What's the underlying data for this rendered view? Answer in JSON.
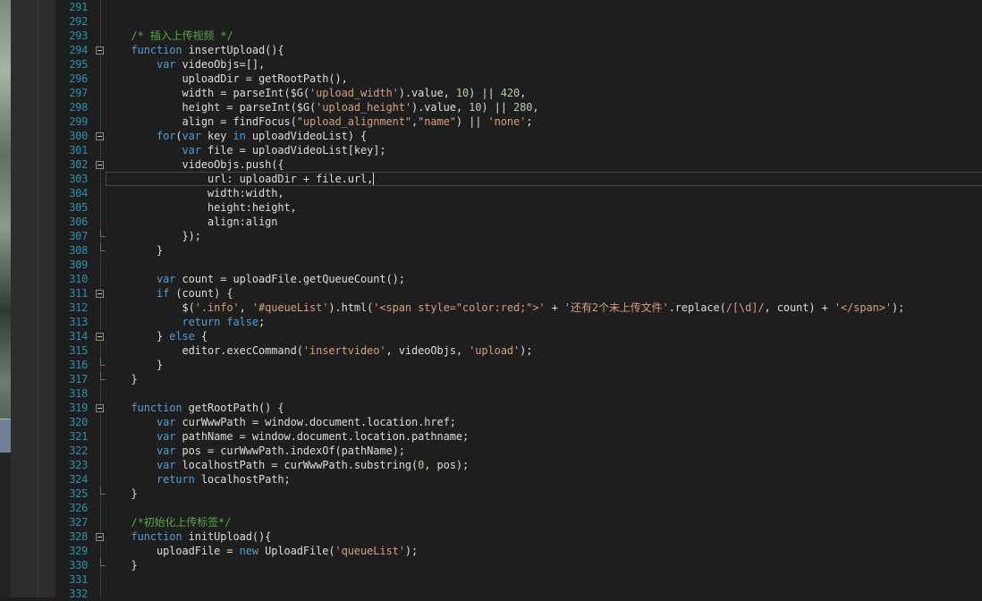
{
  "editor": {
    "lines": [
      {
        "num": "291",
        "tokens": []
      },
      {
        "num": "292",
        "tokens": []
      },
      {
        "num": "293",
        "tokens": [
          {
            "t": "    ",
            "c": "tx"
          },
          {
            "t": "/* 插入上传视频 */",
            "c": "cm"
          }
        ]
      },
      {
        "num": "294",
        "fold": "open",
        "tokens": [
          {
            "t": "    ",
            "c": "tx"
          },
          {
            "t": "function",
            "c": "kw"
          },
          {
            "t": " insertUpload(){",
            "c": "tx"
          }
        ]
      },
      {
        "num": "295",
        "tokens": [
          {
            "t": "        ",
            "c": "tx"
          },
          {
            "t": "var",
            "c": "kw"
          },
          {
            "t": " videoObjs=[],",
            "c": "tx"
          }
        ]
      },
      {
        "num": "296",
        "tokens": [
          {
            "t": "            uploadDir = getRootPath(),",
            "c": "tx"
          }
        ]
      },
      {
        "num": "297",
        "tokens": [
          {
            "t": "            width = parseInt($G(",
            "c": "tx"
          },
          {
            "t": "'upload_width'",
            "c": "str"
          },
          {
            "t": ").value, ",
            "c": "tx"
          },
          {
            "t": "10",
            "c": "num"
          },
          {
            "t": ") || ",
            "c": "tx"
          },
          {
            "t": "420",
            "c": "num"
          },
          {
            "t": ",",
            "c": "tx"
          }
        ]
      },
      {
        "num": "298",
        "tokens": [
          {
            "t": "            height = parseInt($G(",
            "c": "tx"
          },
          {
            "t": "'upload_height'",
            "c": "str"
          },
          {
            "t": ").value, ",
            "c": "tx"
          },
          {
            "t": "10",
            "c": "num"
          },
          {
            "t": ") || ",
            "c": "tx"
          },
          {
            "t": "280",
            "c": "num"
          },
          {
            "t": ",",
            "c": "tx"
          }
        ]
      },
      {
        "num": "299",
        "tokens": [
          {
            "t": "            align = findFocus(",
            "c": "tx"
          },
          {
            "t": "\"upload_alignment\"",
            "c": "str"
          },
          {
            "t": ",",
            "c": "tx"
          },
          {
            "t": "\"name\"",
            "c": "str"
          },
          {
            "t": ") || ",
            "c": "tx"
          },
          {
            "t": "'none'",
            "c": "str"
          },
          {
            "t": ";",
            "c": "tx"
          }
        ]
      },
      {
        "num": "300",
        "fold": "open",
        "tokens": [
          {
            "t": "        ",
            "c": "tx"
          },
          {
            "t": "for",
            "c": "kw"
          },
          {
            "t": "(",
            "c": "tx"
          },
          {
            "t": "var",
            "c": "kw"
          },
          {
            "t": " key ",
            "c": "tx"
          },
          {
            "t": "in",
            "c": "kw"
          },
          {
            "t": " uploadVideoList) {",
            "c": "tx"
          }
        ]
      },
      {
        "num": "301",
        "tokens": [
          {
            "t": "            ",
            "c": "tx"
          },
          {
            "t": "var",
            "c": "kw"
          },
          {
            "t": " file = uploadVideoList[key];",
            "c": "tx"
          }
        ]
      },
      {
        "num": "302",
        "fold": "open",
        "tokens": [
          {
            "t": "            videoObjs.push({",
            "c": "tx"
          }
        ]
      },
      {
        "num": "303",
        "current": true,
        "tokens": [
          {
            "t": "                url: uploadDir + file.url,",
            "c": "tx"
          }
        ]
      },
      {
        "num": "304",
        "tokens": [
          {
            "t": "                width:width,",
            "c": "tx"
          }
        ]
      },
      {
        "num": "305",
        "tokens": [
          {
            "t": "                height:height,",
            "c": "tx"
          }
        ]
      },
      {
        "num": "306",
        "tokens": [
          {
            "t": "                align:align",
            "c": "tx"
          }
        ]
      },
      {
        "num": "307",
        "foldEnd": true,
        "tokens": [
          {
            "t": "            });",
            "c": "tx"
          }
        ]
      },
      {
        "num": "308",
        "foldEnd": true,
        "tokens": [
          {
            "t": "        }",
            "c": "tx"
          }
        ]
      },
      {
        "num": "309",
        "tokens": []
      },
      {
        "num": "310",
        "tokens": [
          {
            "t": "        ",
            "c": "tx"
          },
          {
            "t": "var",
            "c": "kw"
          },
          {
            "t": " count = uploadFile.getQueueCount();",
            "c": "tx"
          }
        ]
      },
      {
        "num": "311",
        "fold": "open",
        "tokens": [
          {
            "t": "        ",
            "c": "tx"
          },
          {
            "t": "if",
            "c": "kw"
          },
          {
            "t": " (count) {",
            "c": "tx"
          }
        ]
      },
      {
        "num": "312",
        "tokens": [
          {
            "t": "            $(",
            "c": "tx"
          },
          {
            "t": "'.info'",
            "c": "str"
          },
          {
            "t": ", ",
            "c": "tx"
          },
          {
            "t": "'#queueList'",
            "c": "str"
          },
          {
            "t": ").html(",
            "c": "tx"
          },
          {
            "t": "'<span style=\"color:red;\">'",
            "c": "str"
          },
          {
            "t": " + ",
            "c": "tx"
          },
          {
            "t": "'还有2个未上传文件'",
            "c": "str"
          },
          {
            "t": ".replace(",
            "c": "tx"
          },
          {
            "t": "/[\\d]/",
            "c": "str"
          },
          {
            "t": ", count) + ",
            "c": "tx"
          },
          {
            "t": "'</span>'",
            "c": "str"
          },
          {
            "t": ");",
            "c": "tx"
          }
        ]
      },
      {
        "num": "313",
        "tokens": [
          {
            "t": "            ",
            "c": "tx"
          },
          {
            "t": "return false",
            "c": "kw"
          },
          {
            "t": ";",
            "c": "tx"
          }
        ]
      },
      {
        "num": "314",
        "fold": "open",
        "tokens": [
          {
            "t": "        } ",
            "c": "tx"
          },
          {
            "t": "else",
            "c": "kw"
          },
          {
            "t": " {",
            "c": "tx"
          }
        ]
      },
      {
        "num": "315",
        "tokens": [
          {
            "t": "            editor.execCommand(",
            "c": "tx"
          },
          {
            "t": "'insertvideo'",
            "c": "str"
          },
          {
            "t": ", videoObjs, ",
            "c": "tx"
          },
          {
            "t": "'upload'",
            "c": "str"
          },
          {
            "t": ");",
            "c": "tx"
          }
        ]
      },
      {
        "num": "316",
        "foldEnd": true,
        "tokens": [
          {
            "t": "        }",
            "c": "tx"
          }
        ]
      },
      {
        "num": "317",
        "foldEnd": true,
        "tokens": [
          {
            "t": "    }",
            "c": "tx"
          }
        ]
      },
      {
        "num": "318",
        "tokens": []
      },
      {
        "num": "319",
        "fold": "open",
        "tokens": [
          {
            "t": "    ",
            "c": "tx"
          },
          {
            "t": "function",
            "c": "kw"
          },
          {
            "t": " getRootPath() {",
            "c": "tx"
          }
        ]
      },
      {
        "num": "320",
        "tokens": [
          {
            "t": "        ",
            "c": "tx"
          },
          {
            "t": "var",
            "c": "kw"
          },
          {
            "t": " curWwwPath = window.document.location.href;",
            "c": "tx"
          }
        ]
      },
      {
        "num": "321",
        "tokens": [
          {
            "t": "        ",
            "c": "tx"
          },
          {
            "t": "var",
            "c": "kw"
          },
          {
            "t": " pathName = window.document.location.pathname;",
            "c": "tx"
          }
        ]
      },
      {
        "num": "322",
        "tokens": [
          {
            "t": "        ",
            "c": "tx"
          },
          {
            "t": "var",
            "c": "kw"
          },
          {
            "t": " pos = curWwwPath.indexOf(pathName);",
            "c": "tx"
          }
        ]
      },
      {
        "num": "323",
        "tokens": [
          {
            "t": "        ",
            "c": "tx"
          },
          {
            "t": "var",
            "c": "kw"
          },
          {
            "t": " localhostPath = curWwwPath.substring(",
            "c": "tx"
          },
          {
            "t": "0",
            "c": "num"
          },
          {
            "t": ", pos);",
            "c": "tx"
          }
        ]
      },
      {
        "num": "324",
        "tokens": [
          {
            "t": "        ",
            "c": "tx"
          },
          {
            "t": "return",
            "c": "kw"
          },
          {
            "t": " localhostPath;",
            "c": "tx"
          }
        ]
      },
      {
        "num": "325",
        "foldEnd": true,
        "tokens": [
          {
            "t": "    }",
            "c": "tx"
          }
        ]
      },
      {
        "num": "326",
        "tokens": []
      },
      {
        "num": "327",
        "tokens": [
          {
            "t": "    ",
            "c": "tx"
          },
          {
            "t": "/*初始化上传标签*/",
            "c": "cm"
          }
        ]
      },
      {
        "num": "328",
        "fold": "open",
        "tokens": [
          {
            "t": "    ",
            "c": "tx"
          },
          {
            "t": "function",
            "c": "kw"
          },
          {
            "t": " initUpload(){",
            "c": "tx"
          }
        ]
      },
      {
        "num": "329",
        "tokens": [
          {
            "t": "        uploadFile = ",
            "c": "tx"
          },
          {
            "t": "new",
            "c": "kw"
          },
          {
            "t": " UploadFile(",
            "c": "tx"
          },
          {
            "t": "'queueList'",
            "c": "str"
          },
          {
            "t": ");",
            "c": "tx"
          }
        ]
      },
      {
        "num": "330",
        "foldEnd": true,
        "tokens": [
          {
            "t": "    }",
            "c": "tx"
          }
        ]
      },
      {
        "num": "331",
        "tokens": []
      },
      {
        "num": "332",
        "tokens": []
      }
    ]
  },
  "colors": {
    "keyword": "#569cd6",
    "string": "#d69d85",
    "comment": "#57a64a",
    "number": "#b5cea8",
    "text": "#dcdcdc",
    "line_number": "#2b91af",
    "background": "#1e1e1e"
  },
  "icons": {
    "fold_open": "collapse-minus-icon"
  }
}
